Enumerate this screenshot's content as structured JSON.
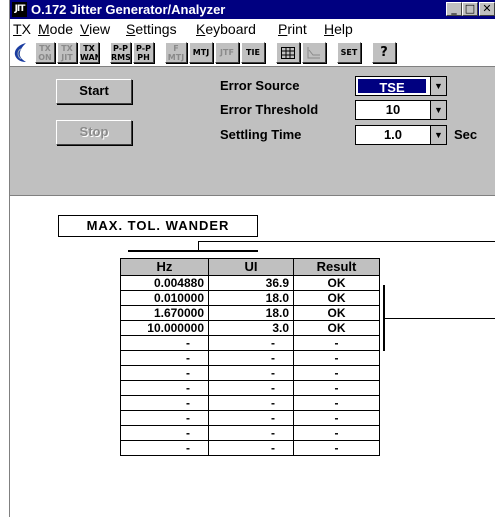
{
  "window": {
    "app_icon": "JIT",
    "title": "O.172 Jitter Generator/Analyzer",
    "controls": [
      "_",
      "□",
      "✕"
    ]
  },
  "menu": [
    {
      "label": "TX",
      "ul": "T",
      "rest": "X"
    },
    {
      "label": "Mode",
      "ul": "M",
      "rest": "ode"
    },
    {
      "label": "View",
      "ul": "V",
      "rest": "iew"
    },
    {
      "label": "Settings",
      "ul": "S",
      "rest": "ettings"
    },
    {
      "label": "Keyboard",
      "ul": "K",
      "rest": "eyboard"
    },
    {
      "label": "Print",
      "ul": "P",
      "rest": "rint"
    },
    {
      "label": "Help",
      "ul": "H",
      "rest": "elp"
    }
  ],
  "toolbar": {
    "tx_on": [
      "TX",
      "ON"
    ],
    "tx_jit": [
      "TX",
      "JIT"
    ],
    "tx_wan": [
      "TX",
      "WAN"
    ],
    "pp_rms": [
      "P-P",
      "RMS"
    ],
    "pp_ph": [
      "P-P",
      "PH"
    ],
    "f_mtj": [
      "F",
      "MTJ"
    ],
    "mtj": "MTJ",
    "jtf": "JTF",
    "tie": "TIE",
    "set": "SET",
    "help": "?"
  },
  "controls": {
    "start_label": "Start",
    "stop_label": "Stop",
    "error_source_label": "Error Source",
    "error_source_value": "TSE",
    "error_threshold_label": "Error Threshold",
    "error_threshold_value": "10",
    "settling_time_label": "Settling Time",
    "settling_time_value": "1.0",
    "settling_time_unit": "Sec"
  },
  "measurement": {
    "title": "MAX. TOL. WANDER",
    "columns": [
      "Hz",
      "UI",
      "Result"
    ],
    "rows": [
      [
        "0.004880",
        "36.9",
        "OK"
      ],
      [
        "0.010000",
        "18.0",
        "OK"
      ],
      [
        "1.670000",
        "18.0",
        "OK"
      ],
      [
        "10.000000",
        "3.0",
        "OK"
      ],
      [
        "-",
        "-",
        "-"
      ],
      [
        "-",
        "-",
        "-"
      ],
      [
        "-",
        "-",
        "-"
      ],
      [
        "-",
        "-",
        "-"
      ],
      [
        "-",
        "-",
        "-"
      ],
      [
        "-",
        "-",
        "-"
      ],
      [
        "-",
        "-",
        "-"
      ],
      [
        "-",
        "-",
        "-"
      ]
    ]
  }
}
